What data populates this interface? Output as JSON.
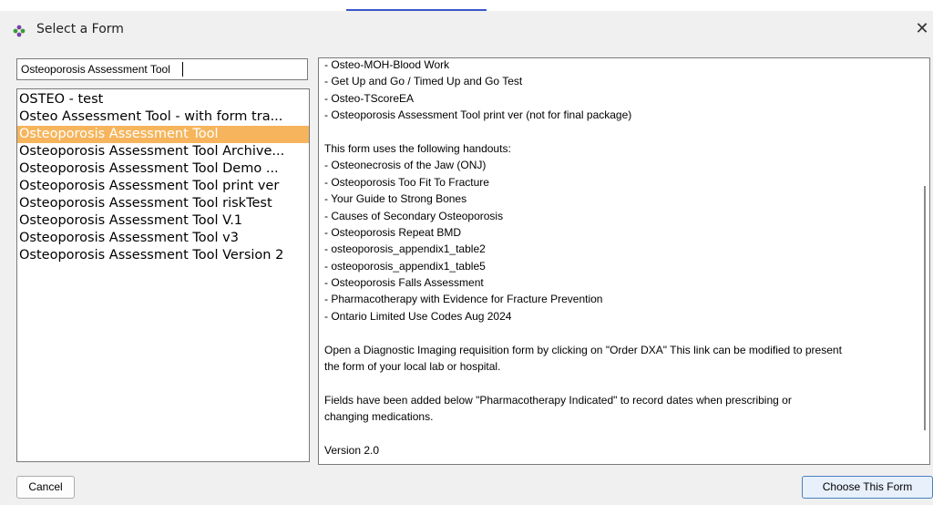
{
  "window": {
    "title": "Select a Form",
    "icon": "form-app-icon",
    "close_glyph": "✕"
  },
  "search": {
    "value": "Osteoporosis Assessment Tool"
  },
  "form_list": {
    "items": [
      "OSTEO - test",
      "Osteo Assessment Tool - with form tra...",
      "Osteoporosis Assessment Tool",
      "Osteoporosis Assessment Tool Archive...",
      "Osteoporosis Assessment Tool Demo ...",
      "Osteoporosis Assessment Tool print ver",
      "Osteoporosis Assessment Tool riskTest",
      "Osteoporosis Assessment Tool V.1",
      "Osteoporosis Assessment Tool v3",
      "Osteoporosis Assessment Tool Version 2"
    ],
    "selected_index": 2
  },
  "description": {
    "lines": [
      "- Osteo-MOH-Blood Work",
      "- Get Up and Go / Timed Up and Go Test",
      "- Osteo-TScoreEA",
      "- Osteoporosis Assessment Tool print ver (not for final package)",
      "",
      "This form uses the following handouts:",
      "- Osteonecrosis of the Jaw (ONJ)",
      "- Osteoporosis Too Fit To Fracture",
      "- Your Guide to Strong Bones",
      "- Causes of Secondary Osteoporosis",
      "- Osteoporosis Repeat BMD",
      "- osteoporosis_appendix1_table2",
      "- osteoporosis_appendix1_table5",
      "- Osteoporosis Falls Assessment",
      "- Pharmacotherapy with Evidence for Fracture Prevention",
      "- Ontario Limited Use Codes Aug 2024",
      "",
      "Open a Diagnostic Imaging requisition form by clicking on \"Order DXA\" This link can be modified to present",
      "the form of your local lab or hospital.",
      "",
      "Fields have been added below \"Pharmacotherapy Indicated\"  to record dates when prescribing or",
      "changing medications.",
      "",
      "Version 2.0"
    ]
  },
  "buttons": {
    "cancel": "Cancel",
    "choose": "Choose This Form"
  },
  "colors": {
    "selection": "#f6b55c",
    "accent": "#3a55c9"
  }
}
